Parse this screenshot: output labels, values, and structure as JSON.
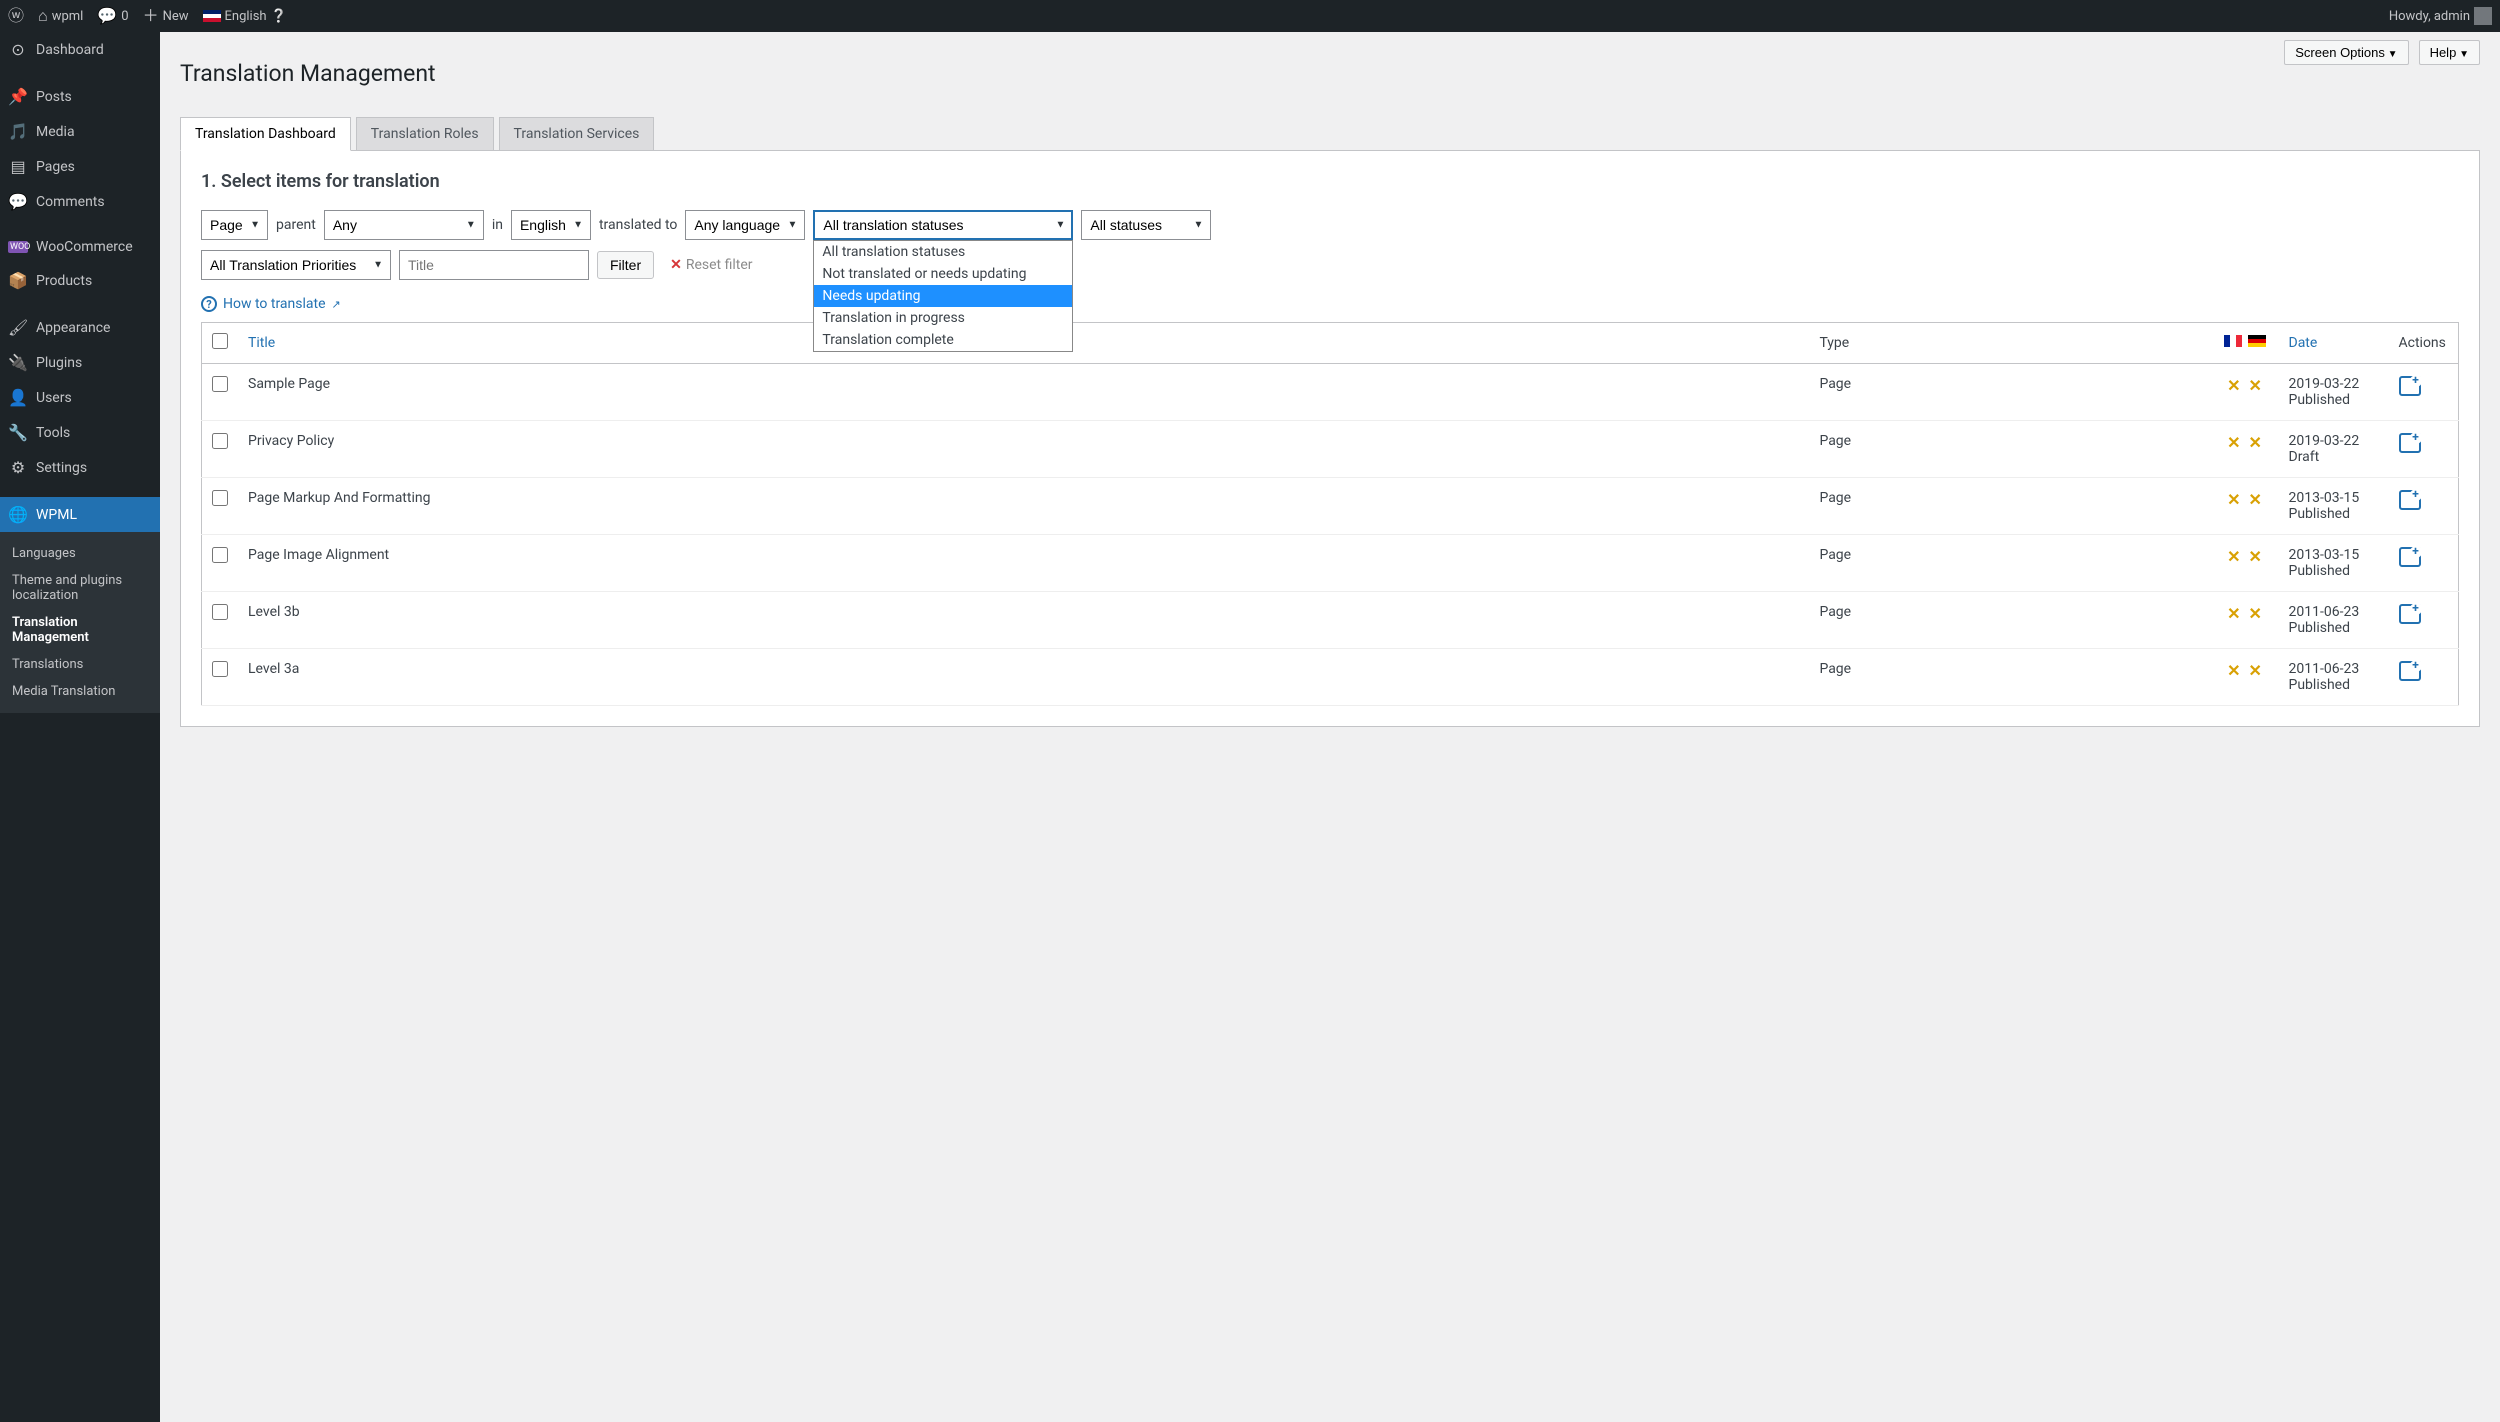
{
  "adminbar": {
    "site": "wpml",
    "comments": "0",
    "new": "New",
    "language": "English",
    "howdy": "Howdy, admin"
  },
  "sidebar": {
    "items": [
      {
        "label": "Dashboard"
      },
      {
        "label": "Posts"
      },
      {
        "label": "Media"
      },
      {
        "label": "Pages"
      },
      {
        "label": "Comments"
      },
      {
        "label": "WooCommerce"
      },
      {
        "label": "Products"
      },
      {
        "label": "Appearance"
      },
      {
        "label": "Plugins"
      },
      {
        "label": "Users"
      },
      {
        "label": "Tools"
      },
      {
        "label": "Settings"
      },
      {
        "label": "WPML"
      }
    ],
    "submenu": [
      {
        "label": "Languages"
      },
      {
        "label": "Theme and plugins localization"
      },
      {
        "label": "Translation Management",
        "current": true
      },
      {
        "label": "Translations"
      },
      {
        "label": "Media Translation"
      }
    ]
  },
  "top_buttons": {
    "screen": "Screen Options",
    "help": "Help"
  },
  "page_title": "Translation Management",
  "tabs": [
    {
      "label": "Translation Dashboard",
      "active": true
    },
    {
      "label": "Translation Roles"
    },
    {
      "label": "Translation Services"
    }
  ],
  "step_heading": "1. Select items for translation",
  "filters": {
    "type_select": "Page",
    "parent_label": "parent",
    "parent_select": "Any",
    "in_label": "in",
    "in_select": "English",
    "translated_to_label": "translated to",
    "to_lang_select": "Any language",
    "trans_status_select": "All translation statuses",
    "status_select": "All statuses",
    "priority_select": "All Translation Priorities",
    "title_placeholder": "Title",
    "filter_btn": "Filter",
    "reset_label": "Reset filter"
  },
  "status_dropdown": {
    "options": [
      "All translation statuses",
      "Not translated or needs updating",
      "Needs updating",
      "Translation in progress",
      "Translation complete"
    ],
    "selected": "Needs updating"
  },
  "howto": "How to translate",
  "table": {
    "headers": {
      "title": "Title",
      "type": "Type",
      "date": "Date",
      "actions": "Actions"
    },
    "rows": [
      {
        "title": "Sample Page",
        "type": "Page",
        "date": "2019-03-22",
        "status": "Published"
      },
      {
        "title": "Privacy Policy",
        "type": "Page",
        "date": "2019-03-22",
        "status": "Draft"
      },
      {
        "title": "Page Markup And Formatting",
        "type": "Page",
        "date": "2013-03-15",
        "status": "Published"
      },
      {
        "title": "Page Image Alignment",
        "type": "Page",
        "date": "2013-03-15",
        "status": "Published"
      },
      {
        "title": "Level 3b",
        "type": "Page",
        "date": "2011-06-23",
        "status": "Published"
      },
      {
        "title": "Level 3a",
        "type": "Page",
        "date": "2011-06-23",
        "status": "Published"
      }
    ]
  }
}
